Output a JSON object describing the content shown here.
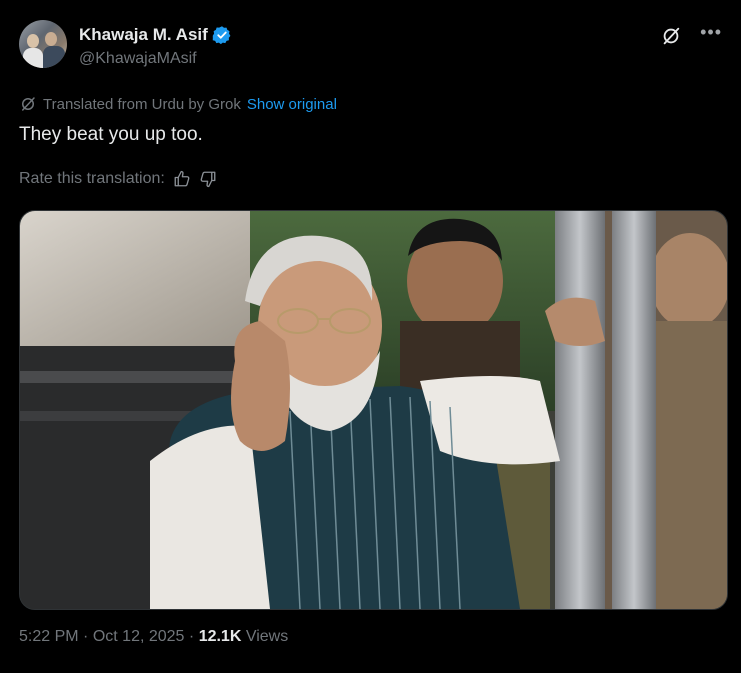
{
  "author": {
    "name": "Khawaja M. Asif",
    "handle": "@KhawajaMAsif"
  },
  "translation": {
    "notice": "Translated from Urdu by Grok",
    "show_original": "Show original"
  },
  "tweet": {
    "text": "They beat you up too."
  },
  "rate": {
    "label": "Rate this translation:"
  },
  "meta": {
    "time": "5:22 PM",
    "date": "Oct 12, 2025",
    "views_count": "12.1K",
    "views_label": "Views",
    "sep": "·"
  },
  "icons": {
    "top_right": [
      "grok-icon",
      "more-icon"
    ],
    "rate": [
      "thumbs-up-icon",
      "thumbs-down-icon"
    ]
  },
  "colors": {
    "link": "#1d9bf0",
    "muted": "#71767b",
    "text": "#e7e9ea",
    "background": "#000000"
  }
}
